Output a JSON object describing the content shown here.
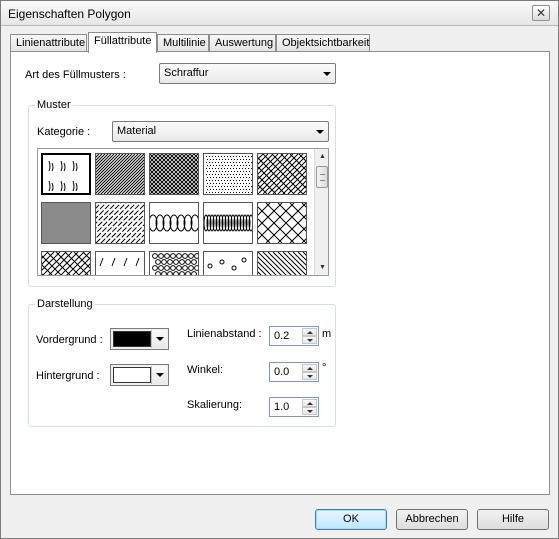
{
  "window": {
    "title": "Eigenschaften Polygon"
  },
  "tabs": [
    {
      "label": "Linienattribute"
    },
    {
      "label": "Füllattribute",
      "active": true
    },
    {
      "label": "Multilinie"
    },
    {
      "label": "Auswertung"
    },
    {
      "label": "Objektsichtbarkeit"
    }
  ],
  "fill": {
    "pattern_type_label": "Art des Füllmusters :",
    "pattern_type_value": "Schraffur"
  },
  "muster": {
    "group_title": "Muster",
    "category_label": "Kategorie :",
    "category_value": "Material",
    "patterns": [
      {
        "name": "raindrops",
        "selected": true
      },
      {
        "name": "diagonal-fine"
      },
      {
        "name": "crosshatch-fine"
      },
      {
        "name": "dots-dense"
      },
      {
        "name": "diagonal-medium"
      },
      {
        "name": "grid-dense"
      },
      {
        "name": "diagonal-dashed"
      },
      {
        "name": "loops"
      },
      {
        "name": "coil"
      },
      {
        "name": "diamond-crosshatch"
      },
      {
        "name": "diagonal-crosshatch"
      },
      {
        "name": "slashes-sparse"
      },
      {
        "name": "brick-circles"
      },
      {
        "name": "scattered-marks"
      },
      {
        "name": "diagonal-wide"
      }
    ]
  },
  "darstellung": {
    "group_title": "Darstellung",
    "foreground_label": "Vordergrund :",
    "foreground_color": "#000000",
    "background_label": "Hintergrund :",
    "background_color": "#ffffff",
    "line_spacing_label": "Linienabstand :",
    "line_spacing_value": "0.2",
    "line_spacing_unit": "m",
    "angle_label": "Winkel:",
    "angle_value": "0.0",
    "angle_unit": "°",
    "scale_label": "Skalierung:",
    "scale_value": "1.0"
  },
  "buttons": {
    "ok": "OK",
    "cancel": "Abbrechen",
    "help": "Hilfe"
  }
}
